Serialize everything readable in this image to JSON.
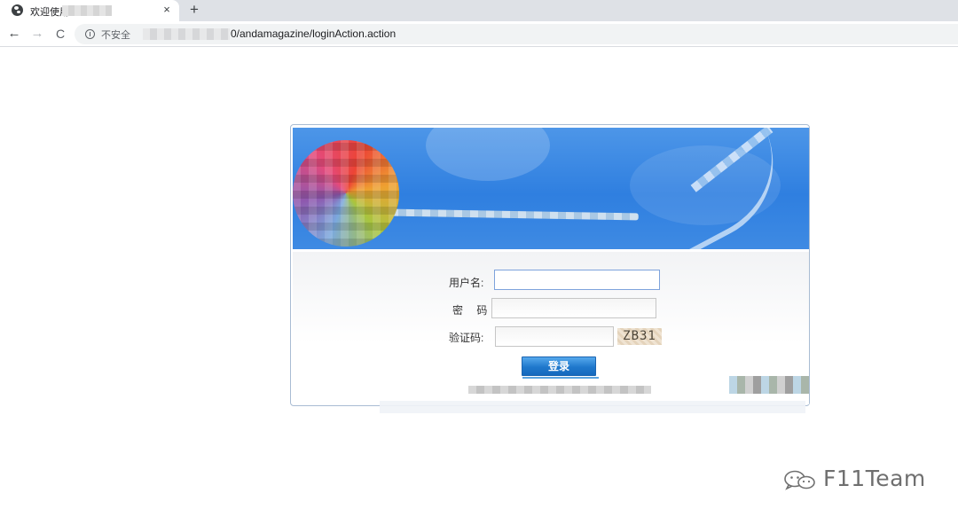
{
  "browser": {
    "tab": {
      "title": "欢迎使用",
      "favicon": "globe-icon",
      "close_glyph": "×"
    },
    "new_tab_glyph": "+",
    "toolbar": {
      "back_glyph": "←",
      "forward_glyph": "→",
      "reload_glyph": "C",
      "security_text": "不安全",
      "url_visible": "0/andamagazine/loginAction.action"
    }
  },
  "login": {
    "username_label": "用户名:",
    "password_label": "密 码:",
    "captcha_label": "验证码:",
    "username_value": "",
    "password_value": "",
    "captcha_value": "",
    "captcha_image_text": "ZB31",
    "submit_label": "登录",
    "accent_color": "#1f78cc"
  },
  "watermark": {
    "text": "F11Team",
    "icon": "wechat-icon"
  }
}
